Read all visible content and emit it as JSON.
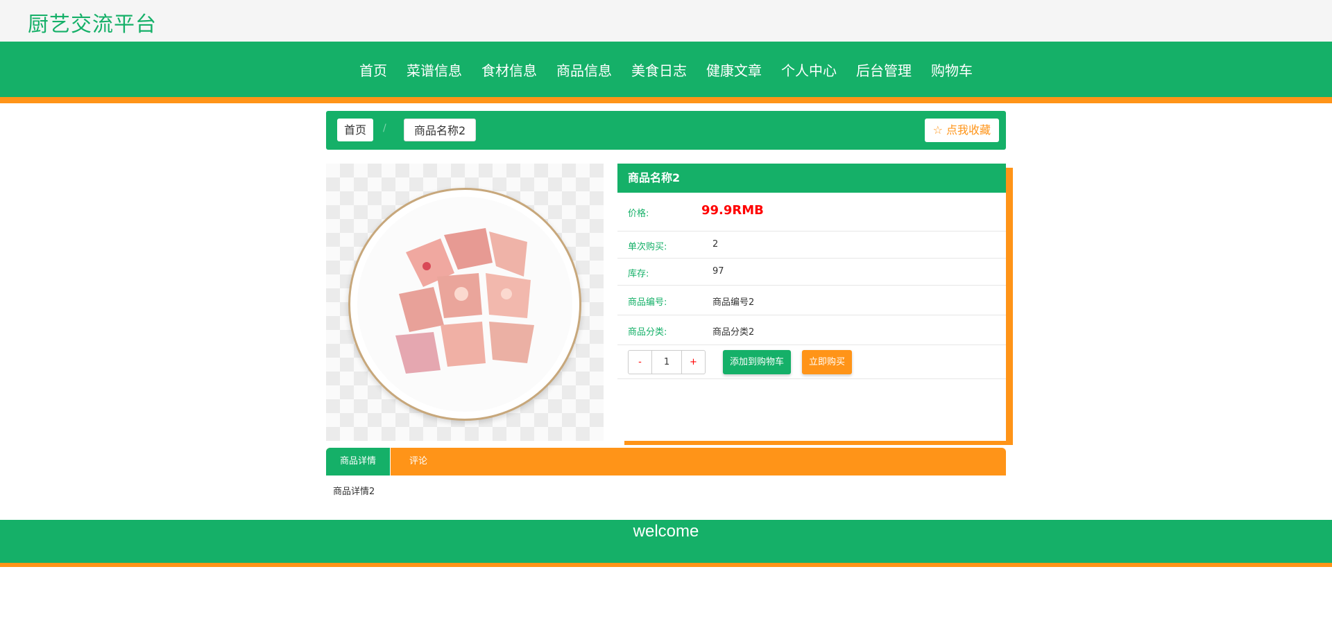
{
  "site": {
    "title": "厨艺交流平台"
  },
  "nav": {
    "items": [
      {
        "label": "首页"
      },
      {
        "label": "菜谱信息"
      },
      {
        "label": "食材信息"
      },
      {
        "label": "商品信息"
      },
      {
        "label": "美食日志"
      },
      {
        "label": "健康文章"
      },
      {
        "label": "个人中心"
      },
      {
        "label": "后台管理"
      },
      {
        "label": "购物车"
      }
    ]
  },
  "breadcrumb": {
    "home": "首页",
    "separator": "/",
    "current": "商品名称2",
    "favorite_label": "☆ 点我收藏"
  },
  "product": {
    "name": "商品名称2",
    "price_label": "价格:",
    "price_value": "99.9RMB",
    "single_purchase_label": "单次购买:",
    "single_purchase_value": "2",
    "stock_label": "库存:",
    "stock_value": "97",
    "code_label": "商品编号:",
    "code_value": "商品编号2",
    "category_label": "商品分类:",
    "category_value": "商品分类2",
    "quantity": "1",
    "minus_label": "-",
    "plus_label": "+",
    "add_to_cart_label": "添加到购物车",
    "buy_now_label": "立即购买"
  },
  "tabs": {
    "detail_label": "商品详情",
    "comment_label": "评论",
    "detail_content": "商品详情2"
  },
  "footer": {
    "text": "welcome"
  },
  "colors": {
    "primary": "#15b068",
    "accent": "#ff9418",
    "price": "#ff0000"
  }
}
